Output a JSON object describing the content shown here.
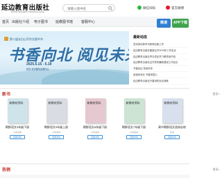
{
  "header": {
    "logo_text": "延边教育出版社",
    "logo_sub": "Yanbian Education Publishing House",
    "search_placeholder": "请输入图书名",
    "wechat_label": "微信扫码",
    "weibo_label": "官方微博"
  },
  "nav": {
    "items": [
      "首页",
      "出版社介绍",
      "电子图书",
      "延教图书馆",
      "客服中心"
    ]
  },
  "banner": {
    "festival_label": "第二届长白山写作文图书节",
    "title": "书香向北  阅见未来",
    "date": "2025.5.15 - 5.19",
    "location": "延吉·延边国际会展中心"
  },
  "news": {
    "title": "最新动态",
    "items": [
      "坚持深化新时代新闻出版工作",
      "延边教育出版社隆重召开2025年工作会议",
      "延边教育出版社举办党纪学习教育读书班",
      "延边教育出版社召开党风廉政建设工作会议",
      "书香延边 悦读未来",
      "阅读伴成长 书香润童心",
      "延边教育出版社开展消防安全演练"
    ],
    "app_btn_1": "微课",
    "app_btn_2": "APP下载"
  },
  "section_new": {
    "title": "新书",
    "more": "更多>"
  },
  "books": [
    {
      "cover_name": "新教材资料",
      "name": "朝鲜语文9年级下册",
      "sub": "小学/初中",
      "btn": "查看详情"
    },
    {
      "cover_name": "新教材资料",
      "name": "朝鲜语文9年级上册",
      "sub": "小学/初中",
      "btn": "查看详情"
    },
    {
      "cover_name": "新教材资料",
      "name": "朝鲜语文8年级下册",
      "sub": "小学/初中",
      "btn": "查看详情"
    },
    {
      "cover_name": "新教材资料",
      "name": "朝鲜语文7年级下册",
      "sub": "小学/初中",
      "btn": "查看详情"
    },
    {
      "cover_name": "新教材资料",
      "name": "高中朝鲜语文选修必修",
      "sub": "高中",
      "btn": "查看详情"
    }
  ],
  "section_hot": {
    "title": "热销",
    "more": "更多>"
  },
  "colors": {
    "accent_red": "#c0392b",
    "banner_blue": "#2e6fa6",
    "cover_1": "#cfe3ea",
    "cover_2": "#d9dde3",
    "cover_3": "#e6c8d0",
    "cover_4": "#cde4d5",
    "cover_5": "#d7e0ec"
  }
}
